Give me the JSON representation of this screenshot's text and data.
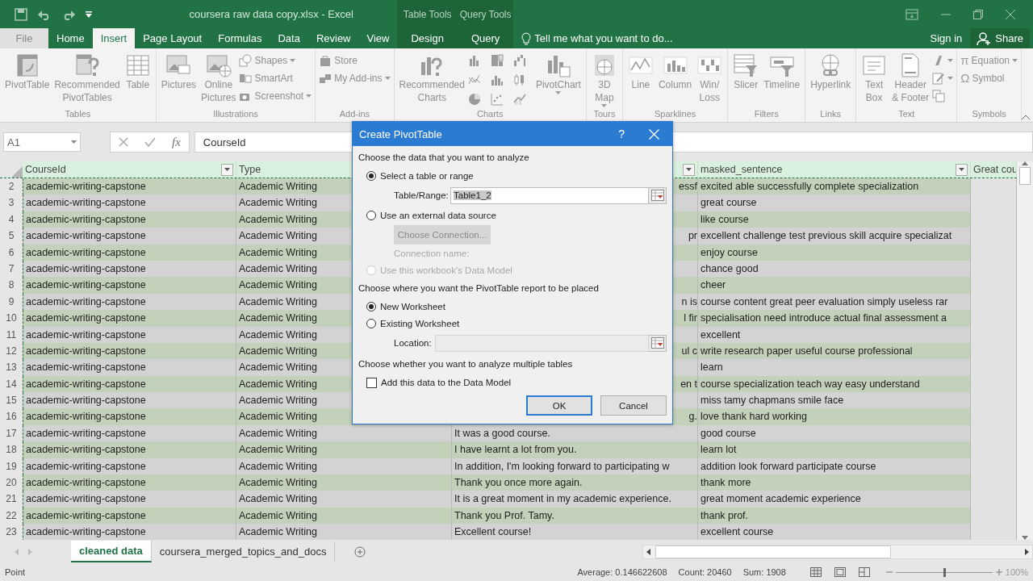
{
  "window": {
    "title": "coursera raw data copy.xlsx - Excel",
    "context_headers": [
      {
        "label": "Table Tools"
      },
      {
        "label": "Query Tools"
      }
    ]
  },
  "ribbon_tabs": [
    {
      "label": "File",
      "kind": "file",
      "selected": false
    },
    {
      "label": "Home",
      "kind": "tab",
      "selected": false
    },
    {
      "label": "Insert",
      "kind": "tab",
      "selected": true
    },
    {
      "label": "Page Layout",
      "kind": "tab",
      "selected": false
    },
    {
      "label": "Formulas",
      "kind": "tab",
      "selected": false
    },
    {
      "label": "Data",
      "kind": "tab",
      "selected": false
    },
    {
      "label": "Review",
      "kind": "tab",
      "selected": false
    },
    {
      "label": "View",
      "kind": "tab",
      "selected": false
    },
    {
      "label": "Design",
      "kind": "context",
      "selected": false
    },
    {
      "label": "Query",
      "kind": "context",
      "selected": false
    }
  ],
  "tell_me": "Tell me what you want to do...",
  "sign_in": "Sign in",
  "share": "Share",
  "ribbon_groups": [
    {
      "label": "Tables",
      "items": [
        {
          "kind": "large",
          "label": "PivotTable",
          "dropdown": false
        },
        {
          "kind": "large",
          "label": "Recommended\nPivotTables",
          "dropdown": false
        },
        {
          "kind": "large",
          "label": "Table",
          "dropdown": false
        }
      ]
    },
    {
      "label": "Illustrations",
      "items": [
        {
          "kind": "large",
          "label": "Pictures",
          "dropdown": false
        },
        {
          "kind": "large",
          "label": "Online\nPictures",
          "dropdown": false
        },
        {
          "kind": "stack",
          "items": [
            {
              "label": "Shapes",
              "dropdown": true
            },
            {
              "label": "SmartArt",
              "dropdown": false
            },
            {
              "label": "Screenshot",
              "dropdown": true
            }
          ]
        }
      ]
    },
    {
      "label": "Add-ins",
      "items": [
        {
          "kind": "stack",
          "items": [
            {
              "label": "Store",
              "dropdown": false
            },
            {
              "label": "My Add-ins",
              "dropdown": true
            }
          ]
        }
      ]
    },
    {
      "label": "Charts",
      "items": [
        {
          "kind": "large",
          "label": "Recommended\nCharts",
          "dropdown": false
        },
        {
          "kind": "grid"
        },
        {
          "kind": "large",
          "label": "PivotChart",
          "dropdown": true
        }
      ]
    },
    {
      "label": "Tours",
      "items": [
        {
          "kind": "large",
          "label": "3D\nMap",
          "dropdown": true
        }
      ]
    },
    {
      "label": "Sparklines",
      "items": [
        {
          "kind": "large",
          "label": "Line",
          "dropdown": false
        },
        {
          "kind": "large",
          "label": "Column",
          "dropdown": false
        },
        {
          "kind": "large",
          "label": "Win/\nLoss",
          "dropdown": false
        }
      ]
    },
    {
      "label": "Filters",
      "items": [
        {
          "kind": "large",
          "label": "Slicer",
          "dropdown": false
        },
        {
          "kind": "large",
          "label": "Timeline",
          "dropdown": false
        }
      ]
    },
    {
      "label": "Links",
      "items": [
        {
          "kind": "large",
          "label": "Hyperlink",
          "dropdown": false
        }
      ]
    },
    {
      "label": "Text",
      "items": [
        {
          "kind": "large",
          "label": "Text\nBox",
          "dropdown": false
        },
        {
          "kind": "large",
          "label": "Header\n& Footer",
          "dropdown": false
        },
        {
          "kind": "stack",
          "items": [
            {
              "dropdown": true
            },
            {
              "dropdown": true
            },
            {
              "dropdown": false
            }
          ]
        }
      ]
    },
    {
      "label": "Symbols",
      "items": [
        {
          "kind": "stack",
          "items": [
            {
              "char": "π",
              "label": "Equation",
              "dropdown": true
            },
            {
              "char": "Ω",
              "label": "Symbol",
              "dropdown": false
            }
          ]
        }
      ]
    }
  ],
  "formula_bar": {
    "name_box": "A1",
    "fx": "fx",
    "formula": "CourseId"
  },
  "columns": [
    {
      "label": "CourseId",
      "filter": true
    },
    {
      "label": "Type"
    },
    {
      "filter": true
    },
    {
      "label": "masked_sentence",
      "filter": true
    },
    {
      "label": "Great cou"
    }
  ],
  "rows": [
    {
      "n": "2",
      "a": "academic-writing-capstone",
      "b": "Academic Writing",
      "c": "essf",
      "c_cut": true,
      "d": "excited able successfully complete specialization"
    },
    {
      "n": "3",
      "a": "academic-writing-capstone",
      "b": "Academic Writing",
      "d": "great course"
    },
    {
      "n": "4",
      "a": "academic-writing-capstone",
      "b": "Academic Writing",
      "d": "like course"
    },
    {
      "n": "5",
      "a": "academic-writing-capstone",
      "b": "Academic Writing",
      "c": "pr",
      "c_cut": true,
      "d": "excellent challenge test previous skill acquire specializat"
    },
    {
      "n": "6",
      "a": "academic-writing-capstone",
      "b": "Academic Writing",
      "d": "enjoy course"
    },
    {
      "n": "7",
      "a": "academic-writing-capstone",
      "b": "Academic Writing",
      "d": "chance good"
    },
    {
      "n": "8",
      "a": "academic-writing-capstone",
      "b": "Academic Writing",
      "d": "cheer"
    },
    {
      "n": "9",
      "a": "academic-writing-capstone",
      "b": "Academic Writing",
      "c": "n is",
      "c_cut": true,
      "d": "course content great peer evaluation simply useless rar"
    },
    {
      "n": "10",
      "a": "academic-writing-capstone",
      "b": "Academic Writing",
      "c": "l fir",
      "c_cut": true,
      "d": "specialisation need introduce actual final assessment a"
    },
    {
      "n": "11",
      "a": "academic-writing-capstone",
      "b": "Academic Writing",
      "d": "excellent"
    },
    {
      "n": "12",
      "a": "academic-writing-capstone",
      "b": "Academic Writing",
      "c": "ul c",
      "c_cut": true,
      "d": "write research paper useful course professional"
    },
    {
      "n": "13",
      "a": "academic-writing-capstone",
      "b": "Academic Writing",
      "d": "learn"
    },
    {
      "n": "14",
      "a": "academic-writing-capstone",
      "b": "Academic Writing",
      "c": "en t",
      "c_cut": true,
      "d": "course specialization teach way easy understand"
    },
    {
      "n": "15",
      "a": "academic-writing-capstone",
      "b": "Academic Writing",
      "d": "miss tamy chapmans smile face"
    },
    {
      "n": "16",
      "a": "academic-writing-capstone",
      "b": "Academic Writing",
      "c": "g.",
      "c_cut": true,
      "d": "love thank hard working"
    },
    {
      "n": "17",
      "a": "academic-writing-capstone",
      "b": "Academic Writing",
      "c": "It was a good course.",
      "c_cut": false,
      "d": "good course"
    },
    {
      "n": "18",
      "a": "academic-writing-capstone",
      "b": "Academic Writing",
      "c": "I have learnt a lot from you.",
      "c_cut": false,
      "d": "learn lot"
    },
    {
      "n": "19",
      "a": "academic-writing-capstone",
      "b": "Academic Writing",
      "c": "In addition, I'm looking forward to participating w",
      "c_cut": false,
      "d": "addition look forward participate course"
    },
    {
      "n": "20",
      "a": "academic-writing-capstone",
      "b": "Academic Writing",
      "c": "Thank you once more again.",
      "c_cut": false,
      "d": "thank more"
    },
    {
      "n": "21",
      "a": "academic-writing-capstone",
      "b": "Academic Writing",
      "c": "It is a great moment in my academic experience.",
      "c_cut": false,
      "d": "great moment academic experience"
    },
    {
      "n": "22",
      "a": "academic-writing-capstone",
      "b": "Academic Writing",
      "c": "Thank you Prof. Tamy.",
      "c_cut": false,
      "d": "thank prof."
    },
    {
      "n": "23",
      "a": "academic-writing-capstone",
      "b": "Academic Writing",
      "c": "Excellent course!",
      "c_cut": false,
      "d": "excellent course"
    }
  ],
  "sheet_tabs": [
    {
      "label": "cleaned data",
      "selected": true
    },
    {
      "label": "coursera_merged_topics_and_docs",
      "selected": false
    }
  ],
  "status_bar": {
    "mode": "Point",
    "stats": [
      "Average: 0.146622608",
      "Count: 20460",
      "Sum: 1908"
    ],
    "zoom": {
      "label": "100%",
      "level": 0.5
    }
  },
  "dialog": {
    "title": "Create PivotTable",
    "help": "?",
    "source_heading": "Choose the data that you want to analyze",
    "source_options": [
      {
        "label": "Select a table or range",
        "selected": true,
        "disabled": false
      },
      {
        "label": "Use an external data source",
        "selected": false,
        "disabled": false
      },
      {
        "label": "Use this workbook's Data Model",
        "selected": false,
        "disabled": true
      }
    ],
    "range": {
      "label": "Table/Range:",
      "value": "Table1_2"
    },
    "connection_button": {
      "label": "Choose Connection...",
      "disabled": true
    },
    "connection_label": {
      "text": "Connection name:",
      "disabled": true
    },
    "place_heading": "Choose where you want the PivotTable report to be placed",
    "place_options": [
      {
        "label": "New Worksheet",
        "selected": true
      },
      {
        "label": "Existing Worksheet",
        "selected": false
      }
    ],
    "location": {
      "label": "Location:",
      "disabled": true
    },
    "tables_heading": "Choose whether you want to analyze multiple tables",
    "data_model": {
      "label": "Add this data to the Data Model",
      "checked": false
    },
    "buttons": [
      {
        "label": "OK",
        "default": true
      },
      {
        "label": "Cancel",
        "default": false
      }
    ]
  }
}
